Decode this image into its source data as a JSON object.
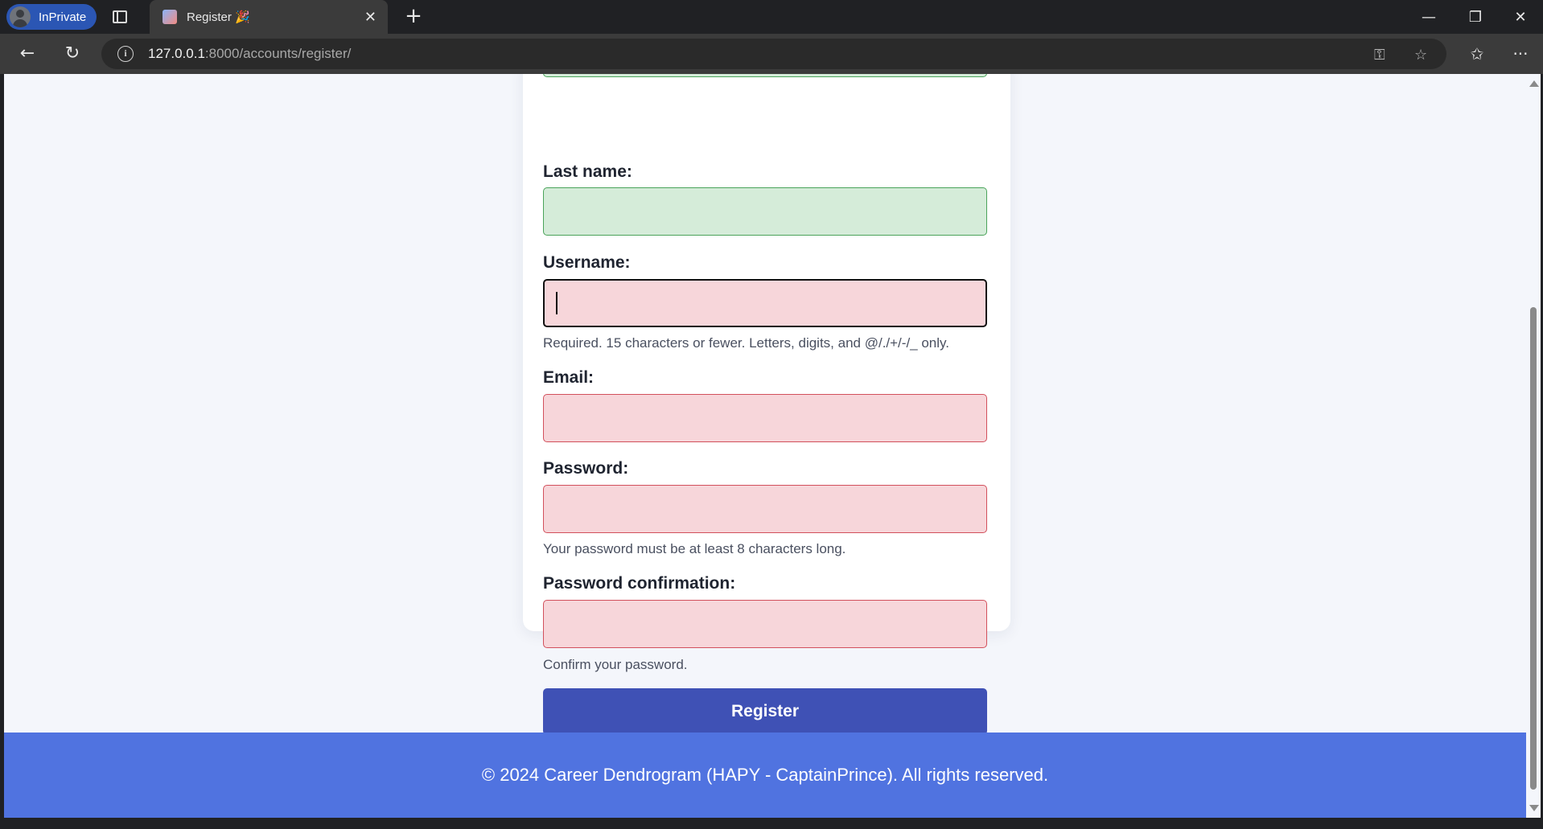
{
  "browser": {
    "profile_label": "InPrivate",
    "tab_title": "Register 🎉",
    "url_host": "127.0.0.1",
    "url_rest": ":8000/accounts/register/"
  },
  "form": {
    "last_name_label": "Last name:",
    "username_label": "Username:",
    "username_help": "Required. 15 characters or fewer. Letters, digits, and @/./+/-/_ only.",
    "email_label": "Email:",
    "password_label": "Password:",
    "password_help": "Your password must be at least 8 characters long.",
    "password_confirm_label": "Password confirmation:",
    "password_confirm_help": "Confirm your password.",
    "register_button": "Register"
  },
  "footer": {
    "text": "© 2024 Career Dendrogram (HAPY - CaptainPrince). All rights reserved."
  },
  "icons": {
    "tab_actions": "tab-actions-icon",
    "favicon": "favicon-icon",
    "close_tab": "close-icon",
    "new_tab": "plus-icon",
    "back": "back-arrow-icon",
    "refresh": "refresh-icon",
    "info": "info-icon",
    "key": "key-icon",
    "favorite": "star-icon",
    "favorites": "favorites-icon",
    "more": "more-icon"
  },
  "colors": {
    "valid_field": "#d5ecd9",
    "invalid_field": "#f7d6da",
    "register_button": "#3f51b5",
    "footer": "#5073e0"
  }
}
